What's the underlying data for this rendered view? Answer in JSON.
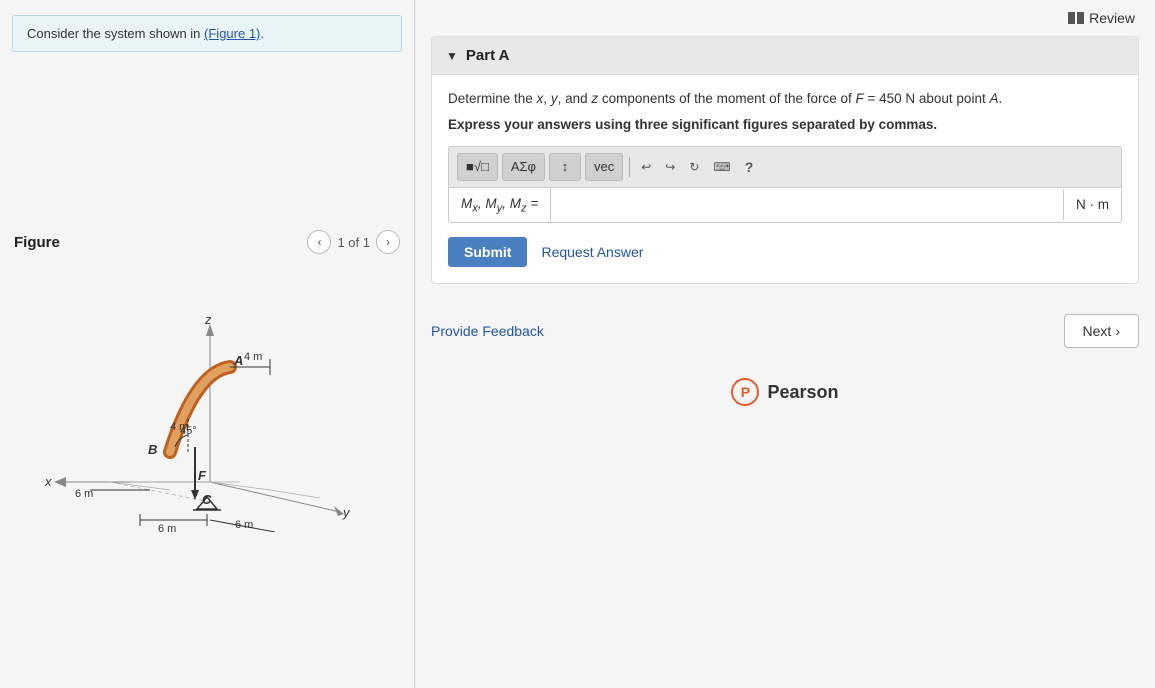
{
  "header": {
    "review_label": "Review"
  },
  "left_panel": {
    "context_text": "Consider the system shown in ",
    "context_link": "(Figure 1)",
    "context_suffix": ".",
    "figure_title": "Figure",
    "figure_page": "1 of 1"
  },
  "part_a": {
    "title": "Part A",
    "problem_line1": "Determine the x, y, and z components of the moment of the force of F = 450  N about point A.",
    "problem_bold": "Express your answers using three significant figures separated by commas.",
    "input_label": "Mx, My, Mz =",
    "unit": "N · m",
    "toolbar": {
      "btn1": "■√□",
      "btn2": "ΑΣφ",
      "btn3": "↕",
      "btn4": "vec",
      "btn_undo": "↩",
      "btn_redo": "↪",
      "btn_refresh": "↻",
      "btn_keyboard": "⌨",
      "btn_help": "?"
    }
  },
  "actions": {
    "submit_label": "Submit",
    "request_answer_label": "Request Answer"
  },
  "bottom": {
    "provide_feedback_label": "Provide Feedback",
    "next_label": "Next"
  },
  "footer": {
    "pearson_initial": "P",
    "pearson_name": "Pearson"
  }
}
